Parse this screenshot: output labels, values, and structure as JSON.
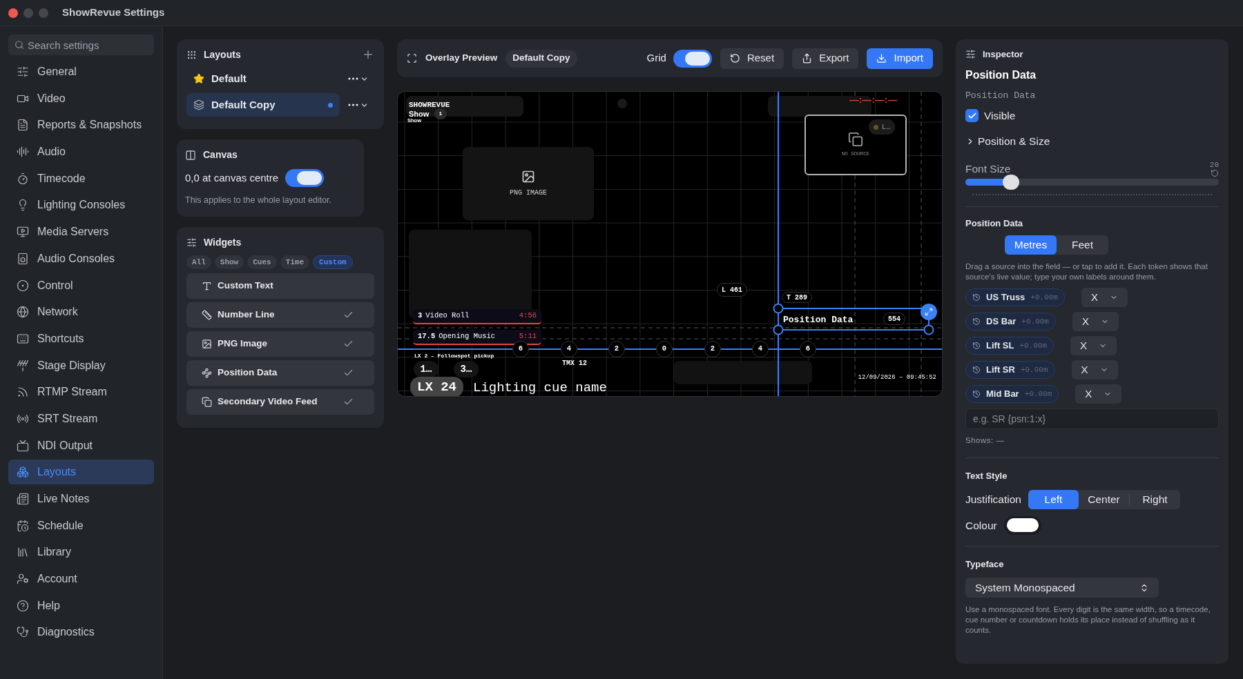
{
  "window": {
    "title": "ShowRevue Settings"
  },
  "sidebar": {
    "search_placeholder": "Search settings",
    "items": [
      {
        "label": "General",
        "selected": false
      },
      {
        "label": "Video",
        "selected": false
      },
      {
        "label": "Reports & Snapshots",
        "selected": false
      },
      {
        "label": "Audio",
        "selected": false
      },
      {
        "label": "Timecode",
        "selected": false
      },
      {
        "label": "Lighting Consoles",
        "selected": false
      },
      {
        "label": "Media Servers",
        "selected": false
      },
      {
        "label": "Audio Consoles",
        "selected": false
      },
      {
        "label": "Control",
        "selected": false
      },
      {
        "label": "Network",
        "selected": false
      },
      {
        "label": "Shortcuts",
        "selected": false
      },
      {
        "label": "Stage Display",
        "selected": false
      },
      {
        "label": "RTMP Stream",
        "selected": false
      },
      {
        "label": "SRT Stream",
        "selected": false
      },
      {
        "label": "NDI Output",
        "selected": false
      },
      {
        "label": "Layouts",
        "selected": true
      },
      {
        "label": "Live Notes",
        "selected": false
      },
      {
        "label": "Schedule",
        "selected": false
      },
      {
        "label": "Library",
        "selected": false
      },
      {
        "label": "Account",
        "selected": false
      },
      {
        "label": "Help",
        "selected": false
      },
      {
        "label": "Diagnostics",
        "selected": false
      }
    ]
  },
  "layouts": {
    "title": "Layouts",
    "items": [
      {
        "label": "Default",
        "kind": "starred",
        "selected": false,
        "modified": false
      },
      {
        "label": "Default Copy",
        "kind": "layers",
        "selected": true,
        "modified": true
      }
    ]
  },
  "canvas": {
    "title": "Canvas",
    "toggle": {
      "label": "0,0 at canvas centre",
      "on": true
    },
    "note": "This applies to the whole layout editor."
  },
  "widgets": {
    "title": "Widgets",
    "filters": [
      {
        "label": "All",
        "selected": false
      },
      {
        "label": "Show",
        "selected": false
      },
      {
        "label": "Cues",
        "selected": false
      },
      {
        "label": "Time",
        "selected": false
      },
      {
        "label": "Custom",
        "selected": true
      }
    ],
    "items": [
      {
        "label": "Custom Text",
        "checked": false
      },
      {
        "label": "Number Line",
        "checked": true
      },
      {
        "label": "PNG Image",
        "checked": true
      },
      {
        "label": "Position Data",
        "checked": true
      },
      {
        "label": "Secondary Video Feed",
        "checked": true
      }
    ]
  },
  "toolbar": {
    "title": "Overlay Preview",
    "layout_badge": "Default Copy",
    "grid": {
      "label": "Grid",
      "on": true
    },
    "buttons": [
      {
        "label": "Reset",
        "kind": "reset"
      },
      {
        "label": "Export",
        "kind": "export"
      },
      {
        "label": "Import",
        "kind": "import"
      }
    ]
  },
  "preview": {
    "brand": "SHOWREVUE",
    "show_label": "Show",
    "show_number": "1",
    "show_caption": "Show",
    "image_label": "PNG IMAGE",
    "video_label": "NO SOURCE",
    "ghost_pill": "L…",
    "clock": "——:——:——:——",
    "cues": [
      {
        "number": "3",
        "name": "Video Roll",
        "time": "4:56"
      },
      {
        "number": "17.5",
        "name": "Opening Music",
        "time": "5:11"
      }
    ],
    "number_line": [
      "6",
      "4",
      "2",
      "0",
      "2",
      "4",
      "6"
    ],
    "followspot": "LX 2 – Followspot pickup",
    "tmx": "TMX 12",
    "chips": [
      "1…",
      "3…"
    ],
    "cue_number": "LX 24",
    "cue_name": "Lighting cue name",
    "timestamp": "12/09/2026 – 09:45:52",
    "selection": {
      "left": "L 461",
      "top": "T 289",
      "label": "Position Data",
      "readout": "554"
    }
  },
  "inspector": {
    "title": "Inspector",
    "heading": "Position Data",
    "subtitle": "Position Data",
    "visible": {
      "label": "Visible",
      "checked": true
    },
    "position_size": {
      "label": "Position & Size",
      "expanded": false
    },
    "font_size": {
      "label": "Font Size",
      "value": "20",
      "level": 0.18
    },
    "position_data": {
      "title": "Position Data",
      "units": [
        {
          "label": "Metres",
          "selected": true
        },
        {
          "label": "Feet",
          "selected": false
        }
      ],
      "help": "Drag a source into the field — or tap to add it. Each token shows that source's live value; type your own labels around them.",
      "sources": [
        {
          "name": "US Truss",
          "value": "+0.00m",
          "axis": "X"
        },
        {
          "name": "DS Bar",
          "value": "+0.00m",
          "axis": "X"
        },
        {
          "name": "Lift SL",
          "value": "+0.00m",
          "axis": "X"
        },
        {
          "name": "Lift SR",
          "value": "+0.00m",
          "axis": "X"
        },
        {
          "name": "Mid Bar",
          "value": "+0.00m",
          "axis": "X"
        }
      ],
      "placeholder": "e.g. SR {psn:1:x}",
      "shows": "Shows: —"
    },
    "text_style": {
      "title": "Text Style",
      "justification_label": "Justification",
      "options": [
        {
          "label": "Left",
          "selected": true
        },
        {
          "label": "Center",
          "selected": false
        },
        {
          "label": "Right",
          "selected": false
        }
      ],
      "colour_label": "Colour",
      "color": "#ffffff"
    },
    "typeface": {
      "title": "Typeface",
      "value": "System Monospaced",
      "help": "Use a monospaced font. Every digit is the same width, so a timecode, cue number or countdown holds its place instead of shuffling as it counts."
    }
  }
}
